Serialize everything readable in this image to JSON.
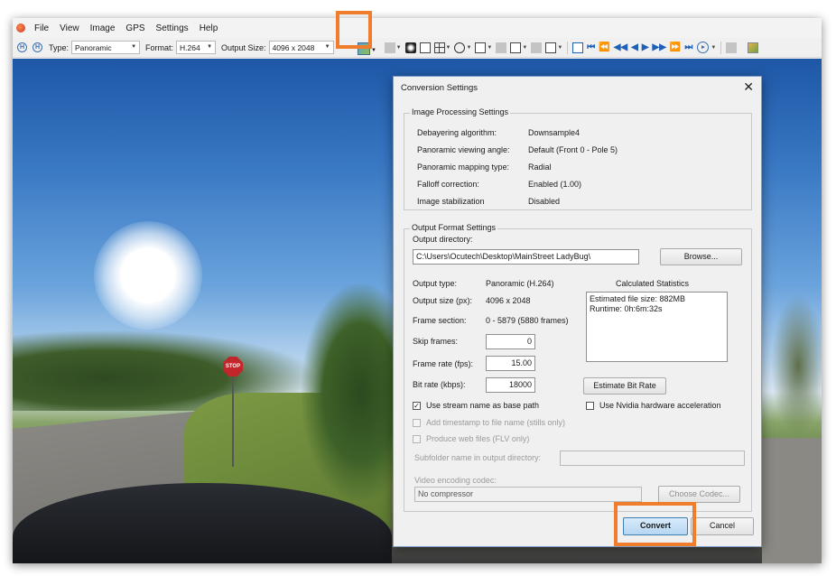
{
  "menu": {
    "items": [
      "File",
      "View",
      "Image",
      "GPS",
      "Settings",
      "Help"
    ]
  },
  "toolbar": {
    "type_label": "Type:",
    "type_value": "Panoramic",
    "format_label": "Format:",
    "format_value": "H.264",
    "output_size_label": "Output Size:",
    "output_size_value": "4096 x 2048",
    "highlight_color": "#ef7d2b"
  },
  "scene": {
    "stop_sign": "STOP"
  },
  "dialog": {
    "title": "Conversion Settings",
    "image_processing": {
      "title": "Image Processing Settings",
      "rows": [
        {
          "label": "Debayering algorithm:",
          "value": "Downsample4"
        },
        {
          "label": "Panoramic viewing angle:",
          "value": "Default (Front 0 - Pole 5)"
        },
        {
          "label": "Panoramic mapping type:",
          "value": "Radial"
        },
        {
          "label": "Falloff correction:",
          "value": "Enabled (1.00)"
        },
        {
          "label": "Image stabilization",
          "value": "Disabled"
        }
      ]
    },
    "output_format": {
      "title": "Output Format Settings",
      "output_directory_label": "Output directory:",
      "output_directory_value": "C:\\Users\\Ocutech\\Desktop\\MainStreet LadyBug\\",
      "browse_label": "Browse...",
      "output_type_label": "Output type:",
      "output_type_value": "Panoramic (H.264)",
      "output_size_label": "Output size (px):",
      "output_size_value": "4096 x 2048",
      "frame_section_label": "Frame section:",
      "frame_section_value": "0 - 5879 (5880 frames)",
      "skip_frames_label": "Skip frames:",
      "skip_frames_value": "0",
      "frame_rate_label": "Frame rate (fps):",
      "frame_rate_value": "15.00",
      "bit_rate_label": "Bit rate (kbps):",
      "bit_rate_value": "18000",
      "estimate_bit_rate_label": "Estimate Bit Rate",
      "stats_title": "Calculated Statistics",
      "stats_file_size": "Estimated file size: 882MB",
      "stats_runtime": "Runtime: 0h:6m:32s",
      "use_stream_name_label": "Use stream name as base path",
      "use_stream_name_checked": true,
      "use_nvidia_label": "Use Nvidia hardware acceleration",
      "use_nvidia_checked": false,
      "add_timestamp_label": "Add timestamp to file name (stills only)",
      "produce_web_label": "Produce web files (FLV only)",
      "subfolder_label": "Subfolder name in output directory:",
      "codec_label": "Video encoding codec:",
      "codec_value": "No compressor",
      "choose_codec_label": "Choose Codec..."
    },
    "convert_label": "Convert",
    "cancel_label": "Cancel"
  }
}
